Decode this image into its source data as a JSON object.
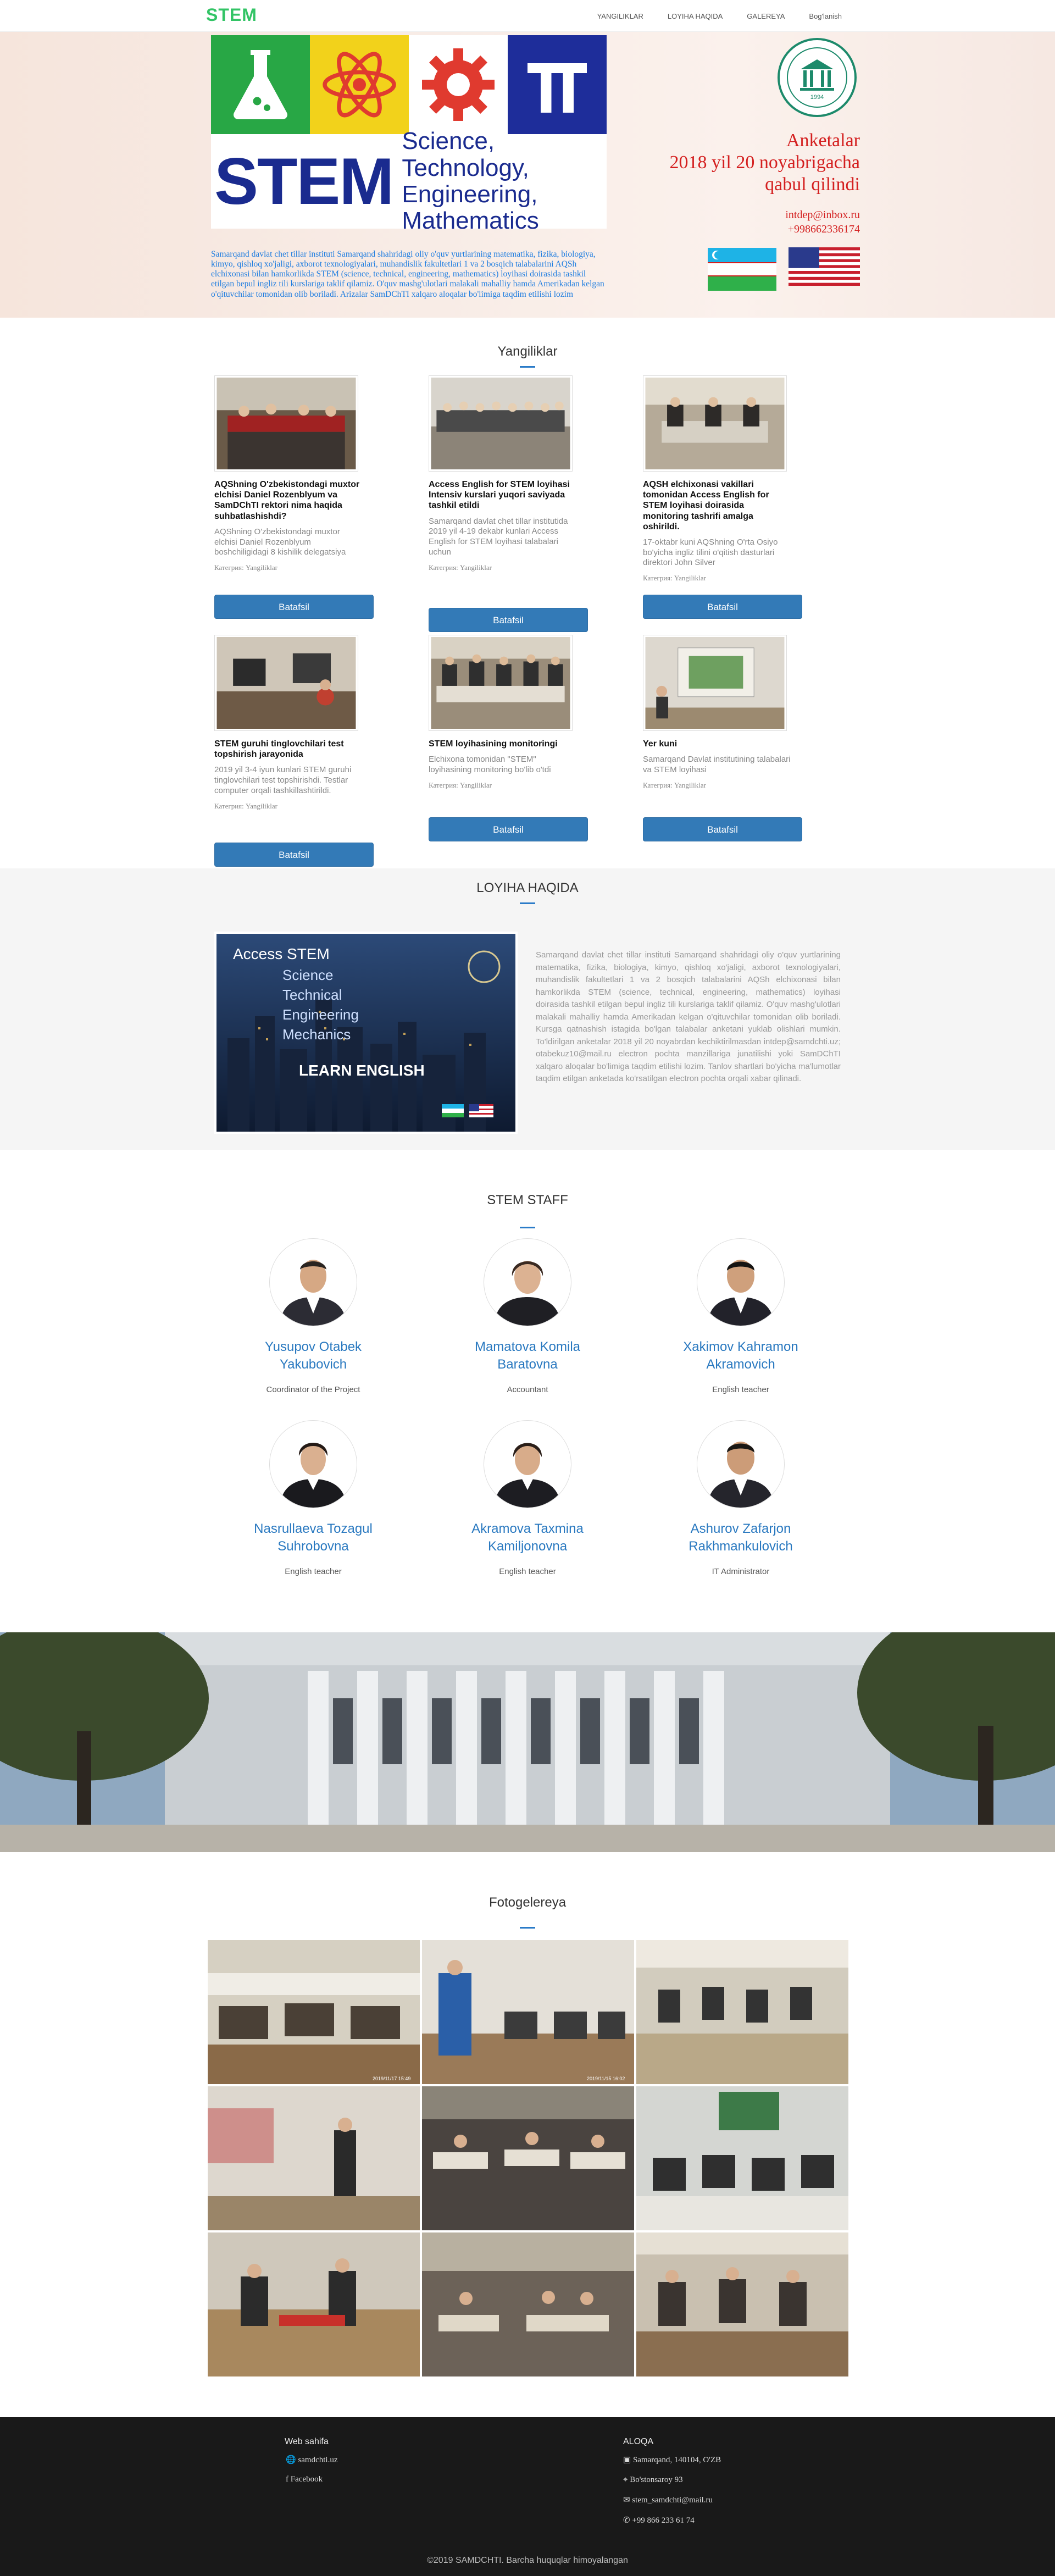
{
  "nav": {
    "brand": "STEM",
    "links": [
      "YANGILIKLAR",
      "LOYIHA HAQIDA",
      "GALEREYA",
      "Bog'lanish"
    ]
  },
  "hero": {
    "stem_word": "STEM",
    "stem_subtitle_lines": [
      "Science, Technology,",
      "Engineering, Mathematics"
    ],
    "description": "Samarqand davlat chet tillar instituti Samarqand shahridagi oliy o'quv yurtlarining matematika, fizika, biologiya, kimyo, qishloq xo'jaligi, axborot texnologiyalari, muhandislik fakultetlari 1 va 2 bosqich talabalarini AQSh elchixonasi bilan hamkorlikda STEM (science, technical, engineering, mathematics) loyihasi doirasida tashkil etilgan bepul ingliz tili kurslariga taklif qilamiz. O'quv mashg'ulotlari malakali mahalliy hamda Amerikadan kelgan o'qituvchilar tomonidan olib boriladi. Arizalar SamDChTI xalqaro aloqalar bo'limiga taqdim etilishi lozim",
    "announcement_lines": [
      "Anketalar",
      "2018 yil 20 noyabrigacha",
      "qabul qilindi"
    ],
    "email": "intdep@inbox.ru",
    "phone": "+998662336174",
    "seal_year": "1994",
    "colors": {
      "science_block": "#28a745",
      "tech_block": "#f2d21b",
      "eng_block": "#e03a2f",
      "math_block": "#1e2d9a",
      "announce": "#d42020"
    }
  },
  "news": {
    "title": "Yangiliklar",
    "button_label": "Batafsil",
    "items": [
      {
        "title": "AQShning O'zbekistondagi muxtor elchisi Daniel Rozenblyum va SamDChTI rektori nima haqida suhbatlashishdi?",
        "text": "AQShning O'zbekistondagi muxtor elchisi Daniel Rozenblyum boshchiligidagi 8 kishilik delegatsiya",
        "category": "Категрия: Yangiliklar"
      },
      {
        "title": "Access English for STEM loyihasi Intensiv kurslari yuqori saviyada tashkil etildi",
        "text": "Samarqand davlat chet tillar institutida 2019 yil 4-19 dekabr kunlari Access English for STEM loyihasi talabalari uchun",
        "category": "Категрия: Yangiliklar"
      },
      {
        "title": "AQSH elchixonasi vakillari tomonidan Access English for STEM loyihasi doirasida monitoring tashrifi amalga oshirildi.",
        "text": "17-oktabr kuni AQShning O'rta Osiyo bo'yicha ingliz tilini o'qitish dasturlari direktori John Silver",
        "category": "Категрия: Yangiliklar"
      },
      {
        "title": "STEM guruhi tinglovchilari test topshirish jarayonida",
        "text": "2019 yil 3-4 iyun kunlari STEM guruhi tinglovchilari test topshirishdi. Testlar computer orqali tashkillashtirildi.",
        "category": "Категрия: Yangiliklar"
      },
      {
        "title": "STEM loyihasining monitoringi",
        "text": "Elchixona tomonidan \"STEM\" loyihasining monitoring bo'lib o'tdi",
        "category": "Категрия: Yangiliklar"
      },
      {
        "title": "Yer kuni",
        "text": "Samarqand Davlat institutining talabalari va STEM loyihasi",
        "category": "Категрия: Yangiliklar"
      }
    ]
  },
  "about": {
    "title": "LOYIHA HAQIDA",
    "poster_lines": [
      "Access STEM",
      "Science",
      "Technical",
      "Engineering",
      "Mechanics",
      "LEARN ENGLISH"
    ],
    "text": "Samarqand davlat chet tillar instituti Samarqand shahridagi oliy o'quv yurtlarining matematika, fizika, biologiya, kimyo, qishloq xo'jaligi, axborot texnologiyalari, muhandislik fakultetlari 1 va 2 bosqich talabalarini AQSh elchixonasi bilan hamkorlikda STEM (science, technical, engineering, mathematics) loyihasi doirasida tashkil etilgan bepul ingliz tili kurslariga taklif qilamiz. O'quv mashg'ulotlari malakali mahalliy hamda Amerikadan kelgan o'qituvchilar tomonidan olib boriladi. Kursga qatnashish istagida bo'lgan talabalar anketani yuklab olishlari mumkin. To'ldirilgan anketalar 2018 yil 20 noyabrdan kechiktirilmasdan intdep@samdchti.uz; otabekuz10@mail.ru electron pochta manzillariga junatilishi yoki SamDChTI xalqaro aloqalar bo'limiga taqdim etilishi lozim. Tanlov shartlari bo'yicha ma'lumotlar taqdim etilgan anketada ko'rsatilgan electron pochta orqali xabar qilinadi."
  },
  "staff": {
    "title": "STEM STAFF",
    "members": [
      {
        "name": "Yusupov Otabek Yakubovich",
        "role": "Coordinator of the Project"
      },
      {
        "name": "Mamatova Komila Baratovna",
        "role": "Accountant"
      },
      {
        "name": "Xakimov Kahramon Akramovich",
        "role": "English teacher"
      },
      {
        "name": "Nasrullaeva Tozagul Suhrobovna",
        "role": "English teacher"
      },
      {
        "name": "Akramova Taxmina Kamiljonovna",
        "role": "English teacher"
      },
      {
        "name": "Ashurov Zafarjon Rakhmankulovich",
        "role": "IT Administrator"
      }
    ]
  },
  "gallery": {
    "title": "Fotogelereya",
    "stamps": [
      "2019/11/17 15:49",
      "2019/11/15 16:02"
    ]
  },
  "footer": {
    "web_title": "Web sahifa",
    "web_links": [
      "samdchti.uz",
      "Facebook"
    ],
    "contact_title": "ALOQA",
    "contact_items": [
      "Samarqand, 140104, O'ZB",
      "Bo'stonsaroy 93",
      "stem_samdchti@mail.ru",
      "+99 866 233 61 74"
    ],
    "copyright": "©2019 SAMDCHTI. Barcha huquqlar himoyalangan"
  }
}
